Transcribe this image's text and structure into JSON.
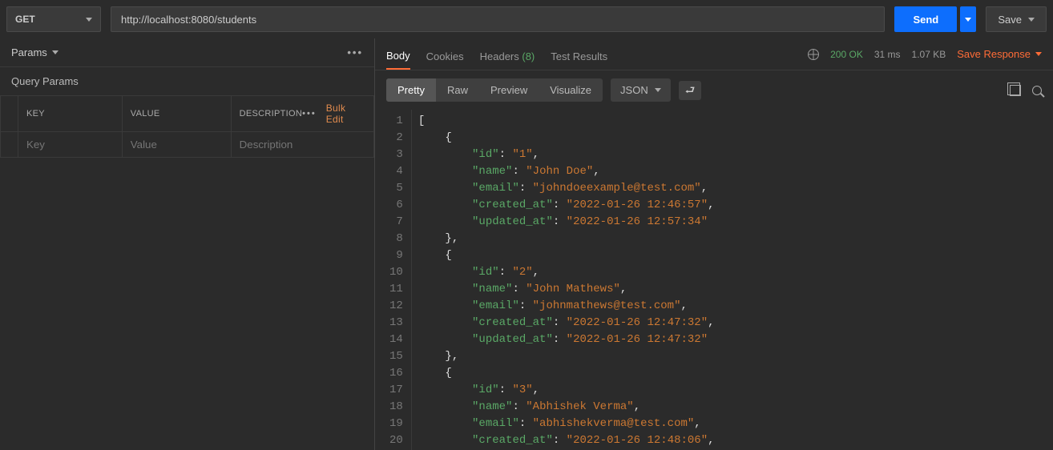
{
  "request": {
    "method": "GET",
    "url": "http://localhost:8080/students",
    "send_label": "Send",
    "save_label": "Save"
  },
  "left_panel": {
    "title": "Params",
    "section_title": "Query Params",
    "columns": {
      "key": "KEY",
      "value": "VALUE",
      "description": "DESCRIPTION"
    },
    "bulk_edit_label": "Bulk Edit",
    "placeholders": {
      "key": "Key",
      "value": "Value",
      "description": "Description"
    }
  },
  "response": {
    "tabs": {
      "body": "Body",
      "cookies": "Cookies",
      "headers": "Headers",
      "headers_count": "(8)",
      "test_results": "Test Results"
    },
    "status": {
      "code": "200 OK",
      "time": "31 ms",
      "size": "1.07 KB"
    },
    "save_response_label": "Save Response",
    "view_modes": {
      "pretty": "Pretty",
      "raw": "Raw",
      "preview": "Preview",
      "visualize": "Visualize"
    },
    "body_type": "JSON",
    "code_lines": [
      {
        "n": 1,
        "tokens": [
          {
            "t": "[",
            "c": "p"
          }
        ]
      },
      {
        "n": 2,
        "tokens": [
          {
            "t": "    ",
            "c": "p"
          },
          {
            "t": "{",
            "c": "p"
          }
        ]
      },
      {
        "n": 3,
        "tokens": [
          {
            "t": "        ",
            "c": "p"
          },
          {
            "t": "\"id\"",
            "c": "k"
          },
          {
            "t": ": ",
            "c": "p"
          },
          {
            "t": "\"1\"",
            "c": "s"
          },
          {
            "t": ",",
            "c": "p"
          }
        ]
      },
      {
        "n": 4,
        "tokens": [
          {
            "t": "        ",
            "c": "p"
          },
          {
            "t": "\"name\"",
            "c": "k"
          },
          {
            "t": ": ",
            "c": "p"
          },
          {
            "t": "\"John Doe\"",
            "c": "s"
          },
          {
            "t": ",",
            "c": "p"
          }
        ]
      },
      {
        "n": 5,
        "tokens": [
          {
            "t": "        ",
            "c": "p"
          },
          {
            "t": "\"email\"",
            "c": "k"
          },
          {
            "t": ": ",
            "c": "p"
          },
          {
            "t": "\"johndoeexample@test.com\"",
            "c": "s"
          },
          {
            "t": ",",
            "c": "p"
          }
        ]
      },
      {
        "n": 6,
        "tokens": [
          {
            "t": "        ",
            "c": "p"
          },
          {
            "t": "\"created_at\"",
            "c": "k"
          },
          {
            "t": ": ",
            "c": "p"
          },
          {
            "t": "\"2022-01-26 12:46:57\"",
            "c": "s"
          },
          {
            "t": ",",
            "c": "p"
          }
        ]
      },
      {
        "n": 7,
        "tokens": [
          {
            "t": "        ",
            "c": "p"
          },
          {
            "t": "\"updated_at\"",
            "c": "k"
          },
          {
            "t": ": ",
            "c": "p"
          },
          {
            "t": "\"2022-01-26 12:57:34\"",
            "c": "s"
          }
        ]
      },
      {
        "n": 8,
        "tokens": [
          {
            "t": "    ",
            "c": "p"
          },
          {
            "t": "},",
            "c": "p"
          }
        ]
      },
      {
        "n": 9,
        "tokens": [
          {
            "t": "    ",
            "c": "p"
          },
          {
            "t": "{",
            "c": "p"
          }
        ]
      },
      {
        "n": 10,
        "tokens": [
          {
            "t": "        ",
            "c": "p"
          },
          {
            "t": "\"id\"",
            "c": "k"
          },
          {
            "t": ": ",
            "c": "p"
          },
          {
            "t": "\"2\"",
            "c": "s"
          },
          {
            "t": ",",
            "c": "p"
          }
        ]
      },
      {
        "n": 11,
        "tokens": [
          {
            "t": "        ",
            "c": "p"
          },
          {
            "t": "\"name\"",
            "c": "k"
          },
          {
            "t": ": ",
            "c": "p"
          },
          {
            "t": "\"John Mathews\"",
            "c": "s"
          },
          {
            "t": ",",
            "c": "p"
          }
        ]
      },
      {
        "n": 12,
        "tokens": [
          {
            "t": "        ",
            "c": "p"
          },
          {
            "t": "\"email\"",
            "c": "k"
          },
          {
            "t": ": ",
            "c": "p"
          },
          {
            "t": "\"johnmathews@test.com\"",
            "c": "s"
          },
          {
            "t": ",",
            "c": "p"
          }
        ]
      },
      {
        "n": 13,
        "tokens": [
          {
            "t": "        ",
            "c": "p"
          },
          {
            "t": "\"created_at\"",
            "c": "k"
          },
          {
            "t": ": ",
            "c": "p"
          },
          {
            "t": "\"2022-01-26 12:47:32\"",
            "c": "s"
          },
          {
            "t": ",",
            "c": "p"
          }
        ]
      },
      {
        "n": 14,
        "tokens": [
          {
            "t": "        ",
            "c": "p"
          },
          {
            "t": "\"updated_at\"",
            "c": "k"
          },
          {
            "t": ": ",
            "c": "p"
          },
          {
            "t": "\"2022-01-26 12:47:32\"",
            "c": "s"
          }
        ]
      },
      {
        "n": 15,
        "tokens": [
          {
            "t": "    ",
            "c": "p"
          },
          {
            "t": "},",
            "c": "p"
          }
        ]
      },
      {
        "n": 16,
        "tokens": [
          {
            "t": "    ",
            "c": "p"
          },
          {
            "t": "{",
            "c": "p"
          }
        ]
      },
      {
        "n": 17,
        "tokens": [
          {
            "t": "        ",
            "c": "p"
          },
          {
            "t": "\"id\"",
            "c": "k"
          },
          {
            "t": ": ",
            "c": "p"
          },
          {
            "t": "\"3\"",
            "c": "s"
          },
          {
            "t": ",",
            "c": "p"
          }
        ]
      },
      {
        "n": 18,
        "tokens": [
          {
            "t": "        ",
            "c": "p"
          },
          {
            "t": "\"name\"",
            "c": "k"
          },
          {
            "t": ": ",
            "c": "p"
          },
          {
            "t": "\"Abhishek Verma\"",
            "c": "s"
          },
          {
            "t": ",",
            "c": "p"
          }
        ]
      },
      {
        "n": 19,
        "tokens": [
          {
            "t": "        ",
            "c": "p"
          },
          {
            "t": "\"email\"",
            "c": "k"
          },
          {
            "t": ": ",
            "c": "p"
          },
          {
            "t": "\"abhishekverma@test.com\"",
            "c": "s"
          },
          {
            "t": ",",
            "c": "p"
          }
        ]
      },
      {
        "n": 20,
        "tokens": [
          {
            "t": "        ",
            "c": "p"
          },
          {
            "t": "\"created_at\"",
            "c": "k"
          },
          {
            "t": ": ",
            "c": "p"
          },
          {
            "t": "\"2022-01-26 12:48:06\"",
            "c": "s"
          },
          {
            "t": ",",
            "c": "p"
          }
        ]
      }
    ]
  }
}
